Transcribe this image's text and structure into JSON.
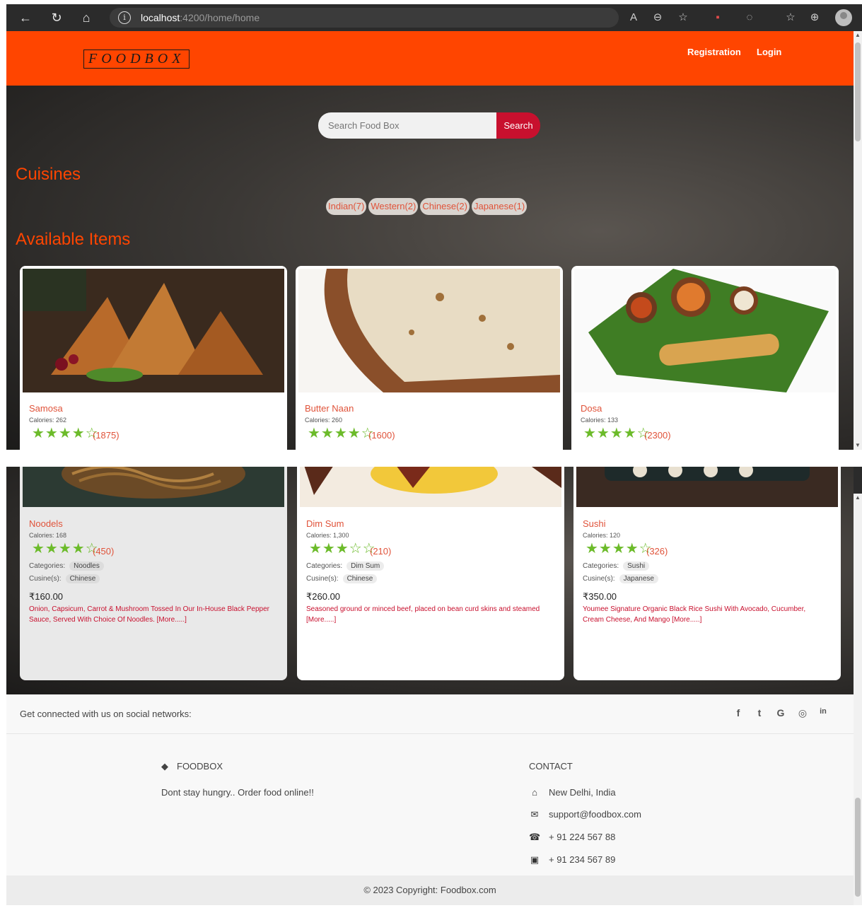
{
  "browser": {
    "url_host": "localhost",
    "url_path": ":4200/home/home"
  },
  "header": {
    "logo": "FOODBOX",
    "nav": [
      "Registration",
      "Login"
    ]
  },
  "search": {
    "placeholder": "Search Food Box",
    "button": "Search"
  },
  "cuisines": {
    "title": "Cuisines",
    "chips": [
      "Indian(7)",
      "Western(2)",
      "Chinese(2)",
      "Japanese(1)"
    ]
  },
  "available": {
    "title": "Available Items"
  },
  "items_top": [
    {
      "name": "Samosa",
      "calories": "Calories: 262",
      "stars": "★★★★☆",
      "count": "(1875)"
    },
    {
      "name": "Butter Naan",
      "calories": "Calories: 260",
      "stars": "★★★★☆",
      "count": "(1600)"
    },
    {
      "name": "Dosa",
      "calories": "Calories: 133",
      "stars": "★★★★☆",
      "count": "(2300)"
    }
  ],
  "items_bottom": [
    {
      "name": "Noodels",
      "calories": "Calories: 168",
      "stars": "★★★★☆",
      "count": "(450)",
      "categories_label": "Categories:",
      "category": "Noodles",
      "cuisine_label": "Cusine(s):",
      "cuisine": "Chinese",
      "price": "₹160.00",
      "desc": "Onion, Capsicum, Carrot & Mushroom Tossed In Our In-House Black Pepper Sauce, Served With Choice Of Noodles. [More.....]"
    },
    {
      "name": "Dim Sum",
      "calories": "Calories: 1,300",
      "stars": "★★★☆☆",
      "count": "(210)",
      "categories_label": "Categories:",
      "category": "Dim Sum",
      "cuisine_label": "Cusine(s):",
      "cuisine": "Chinese",
      "price": "₹260.00",
      "desc": "Seasoned ground or minced beef, placed on bean curd skins and steamed [More.....]"
    },
    {
      "name": "Sushi",
      "calories": "Calories: 120",
      "stars": "★★★★☆",
      "count": "(326)",
      "categories_label": "Categories:",
      "category": "Sushi",
      "cuisine_label": "Cusine(s):",
      "cuisine": "Japanese",
      "price": "₹350.00",
      "desc": "Youmee Signature Organic Black Rice Sushi With Avocado, Cucumber, Cream Cheese, And Mango [More.....]"
    }
  ],
  "footer": {
    "social_text": "Get connected with us on social networks:",
    "social_icons": [
      "f",
      "t",
      "G",
      "◎",
      "in"
    ],
    "brand": "FOODBOX",
    "tagline": "Dont stay hungry.. Order food online!!",
    "contact_title": "CONTACT",
    "address": "New Delhi, India",
    "email": "support@foodbox.com",
    "phone": "+ 91 224 567 88",
    "fax": "+ 91 234 567 89",
    "copyright": "© 2023 Copyright: Foodbox.com"
  }
}
